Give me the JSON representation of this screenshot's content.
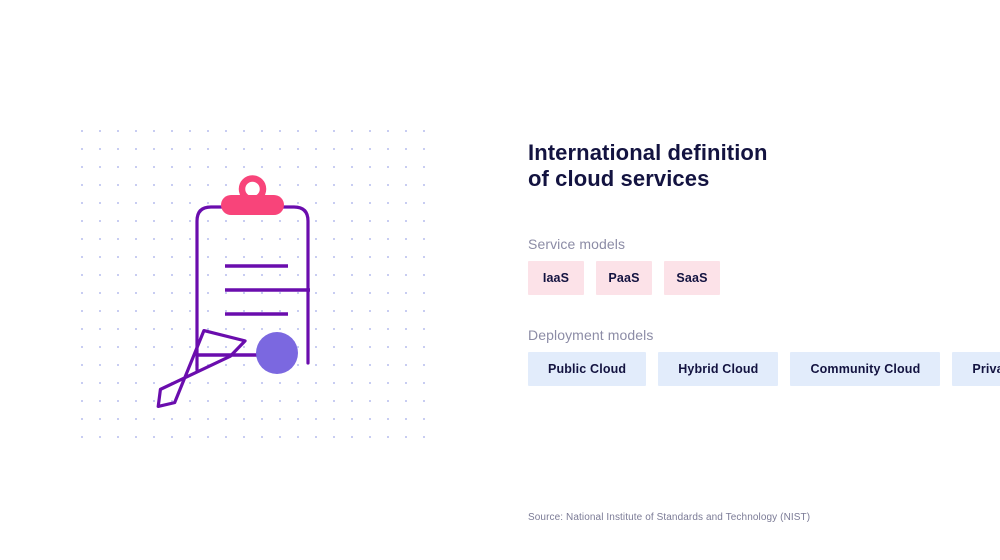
{
  "title": "International definition\nof cloud services",
  "sections": {
    "service_models": {
      "label": "Service models",
      "chips": [
        {
          "label": "IaaS"
        },
        {
          "label": "PaaS"
        },
        {
          "label": "SaaS"
        }
      ]
    },
    "deployment_models": {
      "label": "Deployment models",
      "chips": [
        {
          "label": "Public Cloud"
        },
        {
          "label": "Hybrid Cloud"
        },
        {
          "label": "Community Cloud"
        },
        {
          "label": "Private Cloud"
        }
      ]
    }
  },
  "source": "Source: National Institute of Standards and Technology (NIST)",
  "illustration": {
    "name": "clipboard-with-pencil-illustration",
    "elements": [
      "clipboard",
      "clip",
      "document-lines",
      "pencil",
      "circle-accent",
      "dot-grid-background"
    ]
  },
  "colors": {
    "background": "#ffffff",
    "title_text": "#131340",
    "label_text": "#8c8ca6",
    "source_text": "#7b7b96",
    "chip_service_bg": "#fce2e8",
    "chip_deployment_bg": "#e2ecfb",
    "chip_text": "#131340",
    "illustration_purple": "#6a0dad",
    "illustration_pink": "#f8447a",
    "illustration_circle": "#7b68e0",
    "dot_grid": "#c8cdf2"
  }
}
